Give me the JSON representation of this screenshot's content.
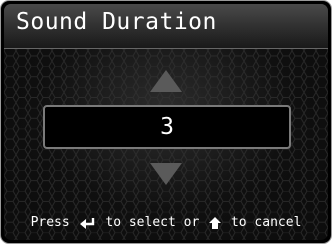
{
  "header": {
    "title": "Sound Duration"
  },
  "selector": {
    "value": "3",
    "increase_icon": "triangle-up-icon",
    "decrease_icon": "triangle-down-icon"
  },
  "hint": {
    "press": "Press",
    "enter_icon": "enter-return-icon",
    "to_select_or": "to select or",
    "home_icon": "home-icon",
    "to_cancel": "to cancel"
  },
  "colors": {
    "text": "#ffffff",
    "background": "#0d0d0d",
    "arrow": "#5a5a5a",
    "box_border": "#7a7a7a"
  }
}
